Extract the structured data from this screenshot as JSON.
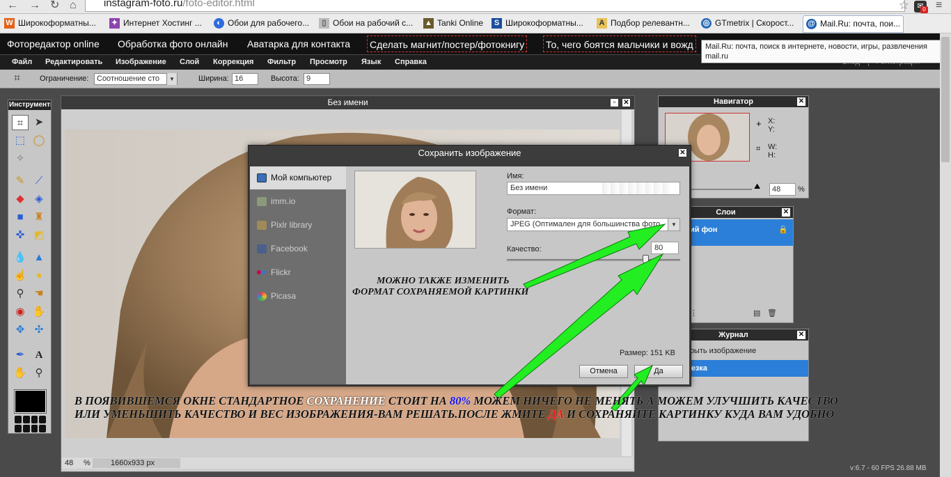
{
  "browser": {
    "url_host": "instagram-foto.ru",
    "url_path": "/foto-editor.html",
    "ext_badge": "0",
    "bookmarks": [
      {
        "label": "Широкоформатны...",
        "icon": "W",
        "color": "#e2621b"
      },
      {
        "label": "Интернет Хостинг ...",
        "icon": "✦",
        "color": "#8e44ad"
      },
      {
        "label": "Обои для рабочего...",
        "icon": "◐",
        "color": "#2d6cdf"
      },
      {
        "label": "Обои на рабочий с...",
        "icon": "▯",
        "color": "#999999"
      },
      {
        "label": "Tanki Online",
        "icon": "▲",
        "color": "#6b5a2a"
      },
      {
        "label": "Широкоформатны...",
        "icon": "S",
        "color": "#1a4d9e"
      },
      {
        "label": "Подбор релевантн...",
        "icon": "A",
        "color": "#e8c25a"
      },
      {
        "label": "GTmetrix | Скорост...",
        "icon": "◎",
        "color": "#2a6bb8"
      },
      {
        "label": "Mail.Ru: почта, пои...",
        "icon": "@",
        "color": "#1d5fb4"
      }
    ]
  },
  "site_menu": [
    "Фоторедактор online",
    "Обработка фото онлайн",
    "Аватарка для контакта",
    "Сделать магнит/постер/фотокнигу",
    "То, чего боятся мальчики и вожд"
  ],
  "tooltip": {
    "line1": "Mail.Ru: почта, поиск в интернете, новости, игры, развлечения",
    "line2": "mail.ru"
  },
  "login": {
    "enter": "Вход",
    "sep": "|",
    "register": "Регистрация"
  },
  "editor_menu": [
    "Файл",
    "Редактировать",
    "Изображение",
    "Слой",
    "Коррекция",
    "Фильтр",
    "Просмотр",
    "Язык",
    "Справка"
  ],
  "options": {
    "constraint_label": "Ограничение:",
    "constraint_value": "Соотношение сто",
    "width_label": "Ширина:",
    "width_value": "16",
    "height_label": "Высота:",
    "height_value": "9"
  },
  "toolbox": {
    "title": "Инструменты"
  },
  "image_window": {
    "title": "Без имени",
    "zoom": "48",
    "zoom_unit": "%",
    "dimensions": "1660x933 px"
  },
  "dialog": {
    "title": "Сохранить изображение",
    "sources": [
      "Мой компьютер",
      "imm.io",
      "Pixlr library",
      "Facebook",
      "Flickr",
      "Picasa"
    ],
    "name_label": "Имя:",
    "name_value": "Без имени",
    "format_label": "Формат:",
    "format_value": "JPEG (Оптимален для большинства фото",
    "quality_label": "Качество:",
    "quality_value": "80",
    "quality_fraction": 0.8,
    "size_label": "Размер: 151 KB",
    "cancel": "Отмена",
    "ok": "Да"
  },
  "navigator": {
    "title": "Навигатор",
    "x_label": "X:",
    "y_label": "Y:",
    "w_label": "W:",
    "h_label": "H:",
    "zoom": "48",
    "zoom_unit": "%"
  },
  "layers": {
    "title": "Слои",
    "layer_name": "ий фон"
  },
  "history": {
    "title": "Журнал",
    "items": [
      "крыть изображение",
      "резка"
    ]
  },
  "version": "v:6.7 - 60 FPS 26.88 MB",
  "annotations": {
    "format_note_1": "МОЖНО ТАКЖЕ ИЗМЕНИТЬ",
    "format_note_2": "ФОРМАТ СОХРАНЯЕМОЙ КАРТИНКИ",
    "line1_a": "В ПОЯВИВШЕМСЯ ОКНЕ  СТАНДАРТНОЕ ",
    "line1_b": "СОХРАНЕНИЕ",
    "line1_c": " СТОИТ НА ",
    "line1_d": "80%",
    "line1_e": " МОЖЕМ НИЧЕГО НЕ МЕНЯТЬ А МОЖЕМ УЛУЧШИТЬ КАЧЕСТВО",
    "line2_a": "ИЛИ УМЕНЬШИТЬ КАЧЕСТВО И ВЕС ИЗОБРАЖЕНИЯ-ВАМ РЕШАТЬ.ПОСЛЕ ЖМИТЕ ",
    "line2_b": "ДА",
    "line2_c": " И СОХРАНЯЙТЕ КАРТИНКУ КУДА ВАМ УДОБНО",
    "arrow_color": "#22ee22",
    "highlight_blue": "#1010ee",
    "highlight_red": "#ee1111"
  }
}
